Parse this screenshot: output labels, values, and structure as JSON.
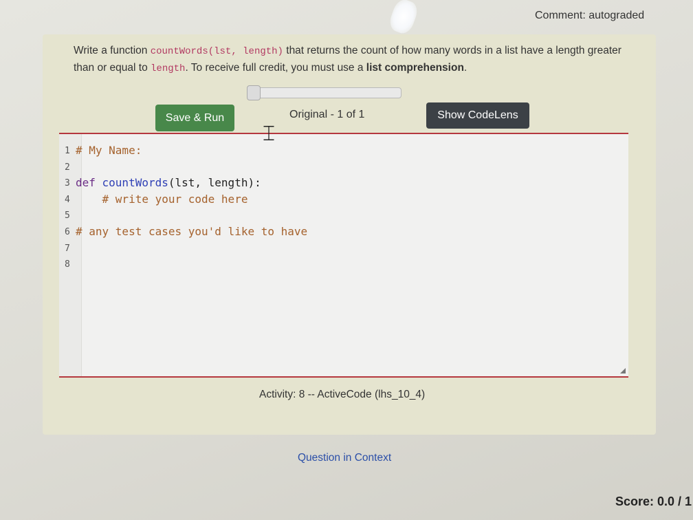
{
  "header": {
    "comment": "Comment: autograded"
  },
  "prompt": {
    "text_before": "Write a function ",
    "signature": "countWords(lst, length)",
    "text_middle": " that returns the count of how many words in a list have a length greater than or equal to ",
    "param": "length",
    "text_after": ". To receive full credit, you must use a ",
    "emphasis": "list comprehension",
    "end": "."
  },
  "toolbar": {
    "run_label": "Save & Run",
    "version_label": "Original - 1 of 1",
    "codelens_label": "Show CodeLens"
  },
  "editor": {
    "lines": [
      {
        "num": "1",
        "segments": [
          {
            "text": "# My Name:",
            "style": "comment"
          }
        ]
      },
      {
        "num": "2",
        "segments": []
      },
      {
        "num": "3",
        "segments": [
          {
            "text": "def ",
            "style": "kw"
          },
          {
            "text": "countWords",
            "style": "fn"
          },
          {
            "text": "(lst, length):",
            "style": "plain"
          }
        ]
      },
      {
        "num": "4",
        "segments": [
          {
            "text": "    # write your code here",
            "style": "comment"
          }
        ]
      },
      {
        "num": "5",
        "segments": []
      },
      {
        "num": "6",
        "segments": [
          {
            "text": "# any test cases you'd like to have",
            "style": "comment"
          }
        ]
      },
      {
        "num": "7",
        "segments": []
      },
      {
        "num": "8",
        "segments": []
      }
    ]
  },
  "footer": {
    "activity": "Activity: 8 -- ActiveCode (lhs_10_4)",
    "context_link": "Question in Context",
    "score": "Score: 0.0 / 1"
  },
  "colors": {
    "run_button": "#48884a",
    "codelens_button": "#3c4146",
    "editor_rule": "#b5373e",
    "link": "#2b4fa8"
  }
}
